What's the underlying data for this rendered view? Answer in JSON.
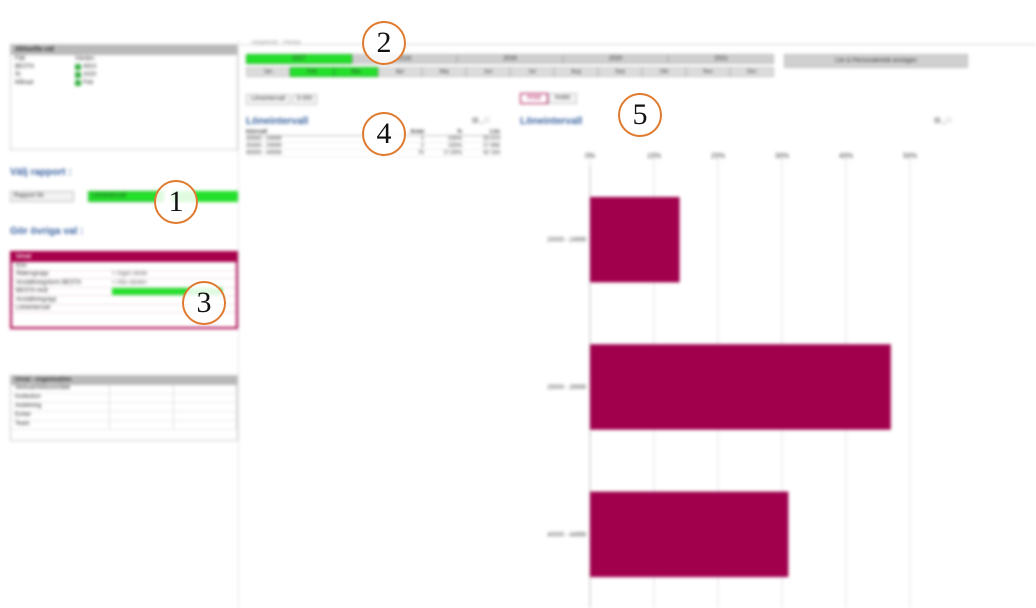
{
  "left": {
    "selection_head": "Aktuella val",
    "selections": [
      {
        "k": "Fält",
        "v": "Värden"
      },
      {
        "k": "BESTA",
        "v": "4910"
      },
      {
        "k": "År",
        "v": "2020"
      },
      {
        "k": "Månad",
        "v": "Feb"
      },
      {
        "k": "",
        "v": ""
      }
    ],
    "valj_rapport_title": "Välj rapport :",
    "rapport_label": "Rapport för",
    "rapport_value": "Löneintervall",
    "ovriga_title": "Gör övriga val :",
    "ovr_head": "Urval",
    "ovr_rows": [
      {
        "k": "Kön",
        "v": ""
      },
      {
        "k": "Åldersgrupp",
        "v": "< Inget värde"
      },
      {
        "k": "Anställningsform BESTA",
        "v": "< Alla värden"
      },
      {
        "k": "BESTA nivå",
        "v": ""
      },
      {
        "k": "Anställningstyp",
        "v": ""
      },
      {
        "k": "Löneintervall",
        "v": ""
      }
    ],
    "org_head": "Urval - organisation",
    "org_rows": [
      "Verksamhetsområde",
      "Institution",
      "Avdelning",
      "Enhet",
      "Team"
    ]
  },
  "top": {
    "title": "Tidsperiod - Period",
    "years": [
      "2017",
      "2018",
      "2019",
      "2020",
      "2021"
    ],
    "months": [
      "Jan",
      "Feb",
      "Mar",
      "Apr",
      "Maj",
      "Jun",
      "Jul",
      "Aug",
      "Sep",
      "Okt",
      "Nov",
      "Dec"
    ],
    "button": "Lön & Personalenkät anslagen"
  },
  "filter": {
    "label": "Löneintervall",
    "value": "5 000"
  },
  "table": {
    "title": "Löneintervall",
    "headers": [
      "Intervall",
      "",
      "Antal",
      "%",
      "Lön"
    ],
    "rows": [
      [
        "20000 - 24999",
        "",
        "1",
        "100%",
        "20 573"
      ],
      [
        "25000 - 29999",
        "",
        "2",
        "100%",
        "27 896"
      ],
      [
        "40000 - 44999",
        "",
        "75",
        "17,00%",
        "42 164"
      ]
    ]
  },
  "tabs": [
    "Antal",
    "Andel"
  ],
  "chart_title": "Löneintervall",
  "icons": {
    "xl": "excel-icon",
    "min": "minimize-icon",
    "max": "maximize-icon"
  },
  "chart_data": {
    "type": "bar",
    "orientation": "horizontal",
    "title": "Löneintervall",
    "categories": [
      "20000 - 24999",
      "25000 - 29999",
      "40000 - 44999"
    ],
    "values": [
      14,
      47,
      31
    ],
    "xlim": [
      0,
      50
    ],
    "xticks": [
      "0%",
      "10%",
      "20%",
      "30%",
      "40%",
      "50%"
    ],
    "color": "#a1004d",
    "grid": true
  },
  "callouts": [
    "1",
    "2",
    "3",
    "4",
    "5"
  ]
}
